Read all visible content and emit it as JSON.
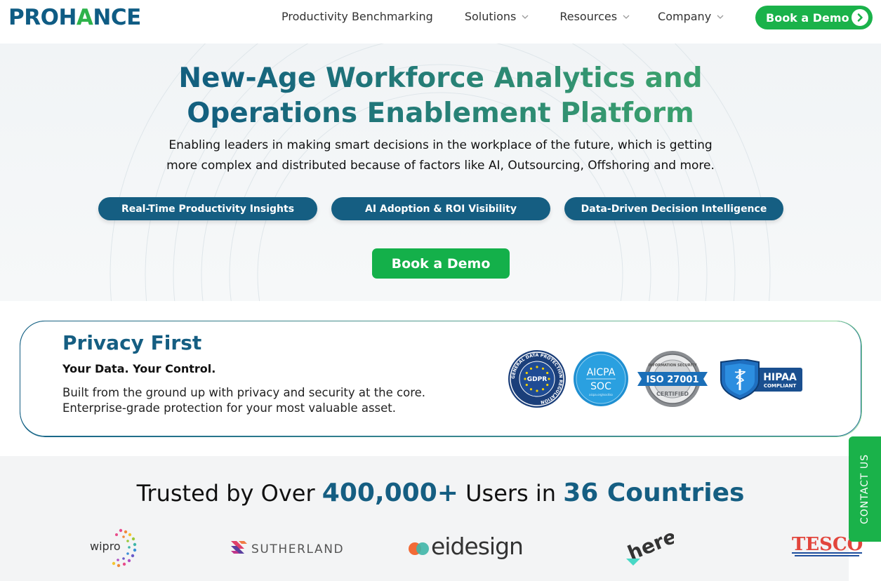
{
  "brand": {
    "logo_pre": "PROH",
    "logo_accent": "A",
    "logo_post": "NCE"
  },
  "nav": {
    "items": [
      {
        "label": "Productivity Benchmarking",
        "has_dropdown": false
      },
      {
        "label": "Solutions",
        "has_dropdown": true
      },
      {
        "label": "Resources",
        "has_dropdown": true
      },
      {
        "label": "Company",
        "has_dropdown": true
      }
    ],
    "cta_label": "Book a Demo"
  },
  "hero": {
    "title_line1": "New-Age Workforce Analytics and",
    "title_line2": "Operations Enablement Platform",
    "subtitle_line1": "Enabling leaders in making smart decisions in the workplace of the future, which is getting",
    "subtitle_line2": "more complex and distributed because of factors like AI, Outsourcing, Offshoring and more.",
    "pills": [
      "Real-Time Productivity Insights",
      "AI Adoption & ROI Visibility",
      "Data-Driven Decision Intelligence"
    ],
    "cta_label": "Book a Demo"
  },
  "privacy": {
    "title": "Privacy First",
    "subtitle": "Your Data. Your Control.",
    "body_line1": "Built from the ground up with privacy and security at the core.",
    "body_line2": "Enterprise-grade protection for your most valuable asset.",
    "badges": {
      "gdpr": {
        "ring_text": "GENERAL DATA PROTECTION REGULATION",
        "center": "GDPR"
      },
      "aicpa": {
        "line1": "AICPA",
        "line2": "SOC",
        "small": "aicpa.org/soc4so"
      },
      "iso": {
        "label": "ISO 27001",
        "top": "INFORMATION SECURITY",
        "bottom": "CERTIFIED"
      },
      "hipaa": {
        "line1": "HIPAA",
        "line2": "COMPLIANT"
      }
    }
  },
  "contact_tab": {
    "label": "CONTACT US"
  },
  "trusted": {
    "prefix": "Trusted by Over ",
    "users": "400,000+",
    "middle": " Users in ",
    "countries": "36 Countries",
    "logos": {
      "wipro": "wipro",
      "sutherland": "SUTHERLAND",
      "eidesign": "eidesign",
      "here": "here",
      "tesco": "TESCO"
    }
  },
  "colors": {
    "brand_blue": "#155e82",
    "brand_green": "#1ab24a",
    "hero_bg": "#f1f4f6",
    "trusted_bg": "#f3f4f5"
  }
}
